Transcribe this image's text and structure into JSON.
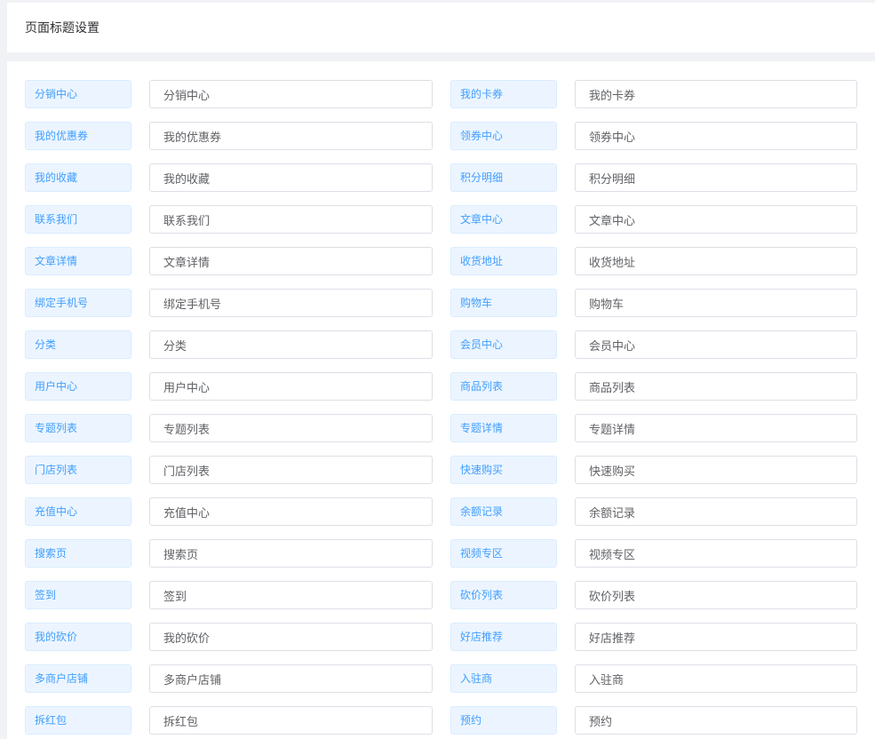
{
  "header": {
    "title": "页面标题设置"
  },
  "rows": [
    {
      "left": {
        "label": "分销中心",
        "value": "分销中心"
      },
      "right": {
        "label": "我的卡券",
        "value": "我的卡券"
      }
    },
    {
      "left": {
        "label": "我的优惠券",
        "value": "我的优惠券"
      },
      "right": {
        "label": "领券中心",
        "value": "领券中心"
      }
    },
    {
      "left": {
        "label": "我的收藏",
        "value": "我的收藏"
      },
      "right": {
        "label": "积分明细",
        "value": "积分明细"
      }
    },
    {
      "left": {
        "label": "联系我们",
        "value": "联系我们"
      },
      "right": {
        "label": "文章中心",
        "value": "文章中心"
      }
    },
    {
      "left": {
        "label": "文章详情",
        "value": "文章详情"
      },
      "right": {
        "label": "收货地址",
        "value": "收货地址"
      }
    },
    {
      "left": {
        "label": "绑定手机号",
        "value": "绑定手机号"
      },
      "right": {
        "label": "购物车",
        "value": "购物车"
      }
    },
    {
      "left": {
        "label": "分类",
        "value": "分类"
      },
      "right": {
        "label": "会员中心",
        "value": "会员中心"
      }
    },
    {
      "left": {
        "label": "用户中心",
        "value": "用户中心"
      },
      "right": {
        "label": "商品列表",
        "value": "商品列表"
      }
    },
    {
      "left": {
        "label": "专题列表",
        "value": "专题列表"
      },
      "right": {
        "label": "专题详情",
        "value": "专题详情"
      }
    },
    {
      "left": {
        "label": "门店列表",
        "value": "门店列表"
      },
      "right": {
        "label": "快速购买",
        "value": "快速购买"
      }
    },
    {
      "left": {
        "label": "充值中心",
        "value": "充值中心"
      },
      "right": {
        "label": "余额记录",
        "value": "余额记录"
      }
    },
    {
      "left": {
        "label": "搜索页",
        "value": "搜索页"
      },
      "right": {
        "label": "视频专区",
        "value": "视频专区"
      }
    },
    {
      "left": {
        "label": "签到",
        "value": "签到"
      },
      "right": {
        "label": "砍价列表",
        "value": "砍价列表"
      }
    },
    {
      "left": {
        "label": "我的砍价",
        "value": "我的砍价"
      },
      "right": {
        "label": "好店推荐",
        "value": "好店推荐"
      }
    },
    {
      "left": {
        "label": "多商户店铺",
        "value": "多商户店铺"
      },
      "right": {
        "label": "入驻商",
        "value": "入驻商"
      }
    },
    {
      "left": {
        "label": "拆红包",
        "value": "拆红包"
      },
      "right": {
        "label": "预约",
        "value": "预约"
      }
    }
  ]
}
